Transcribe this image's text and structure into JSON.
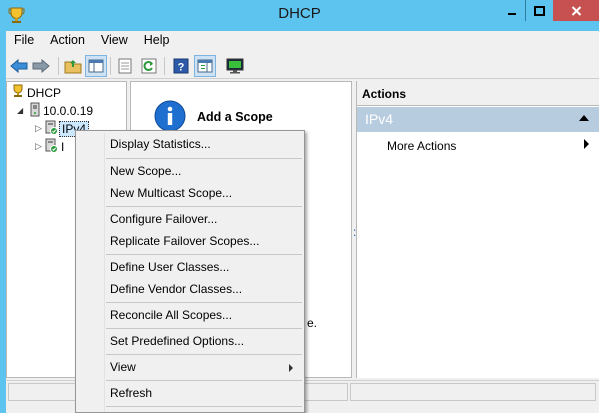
{
  "window": {
    "title": "DHCP"
  },
  "menubar": {
    "items": [
      "File",
      "Action",
      "View",
      "Help"
    ]
  },
  "tree": {
    "root": "DHCP",
    "server": "10.0.0.19",
    "ipv4": "IPv4",
    "ipv6_partial": "I"
  },
  "center": {
    "heading": "Add a Scope",
    "link_fragment_1": ":",
    "link_fragment_2": "e."
  },
  "actions": {
    "header": "Actions",
    "section": "IPv4",
    "more": "More Actions"
  },
  "context_menu": {
    "items": [
      "Display Statistics...",
      "New Scope...",
      "New Multicast Scope...",
      "Configure Failover...",
      "Replicate Failover Scopes...",
      "Define User Classes...",
      "Define Vendor Classes...",
      "Reconcile All Scopes...",
      "Set Predefined Options...",
      "View",
      "Refresh"
    ]
  },
  "colors": {
    "titlebar": "#5cc4ee",
    "close_button": "#c75050",
    "actions_section": "#b8cce0",
    "selection": "#cce8ff"
  },
  "icons": [
    "dhcp-trophy-icon",
    "server-icon",
    "ipv4-icon",
    "ipv6-icon",
    "back-arrow-icon",
    "forward-arrow-icon",
    "up-folder-icon",
    "show-hide-tree-icon",
    "properties-icon",
    "refresh-icon",
    "help-icon",
    "show-action-pane-icon",
    "monitor-icon",
    "info-icon"
  ]
}
